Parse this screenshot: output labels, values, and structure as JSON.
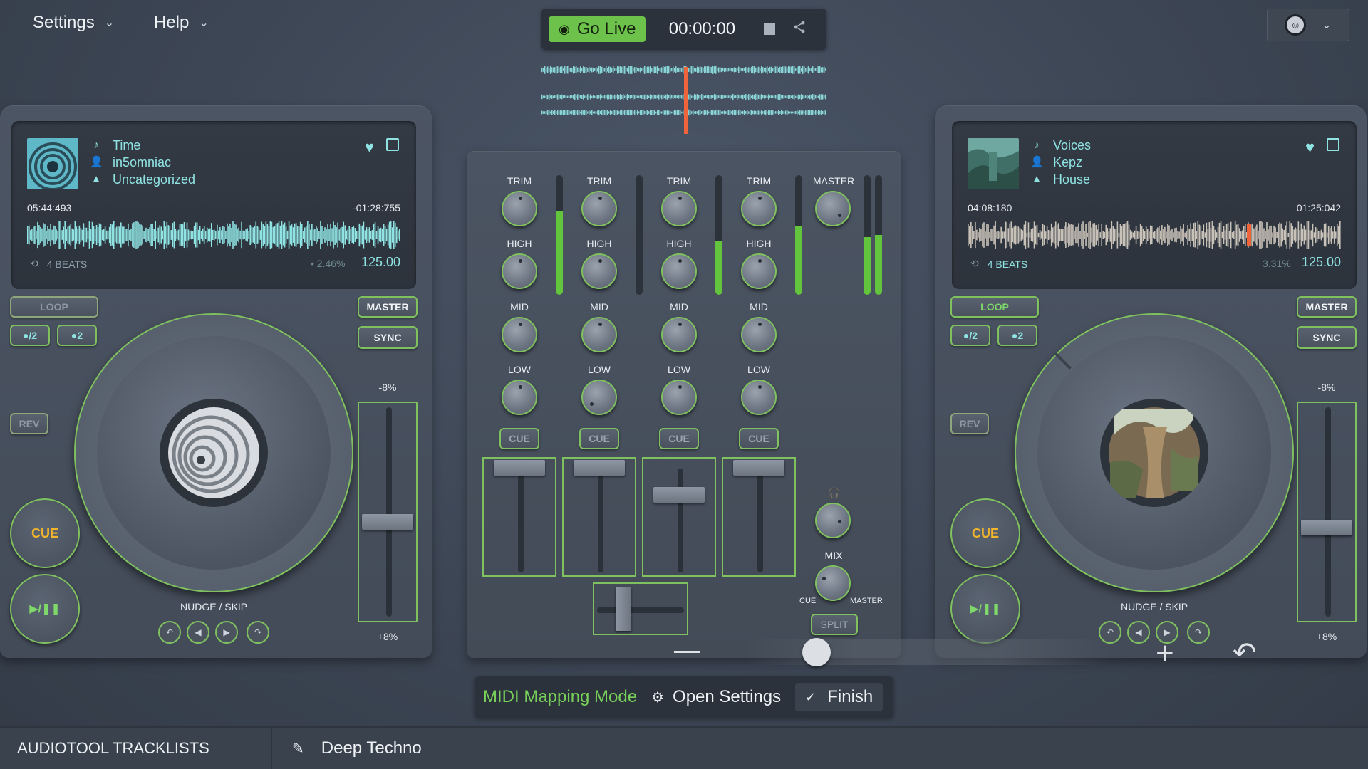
{
  "menu": {
    "settings": "Settings",
    "help": "Help"
  },
  "transport": {
    "go_live": "Go Live",
    "timer": "00:00:00"
  },
  "deck_a": {
    "title": "Time",
    "artist": "in5omniac",
    "genre": "Uncategorized",
    "elapsed": "05:44:493",
    "remaining": "-01:28:755",
    "loop_length": "4 BEATS",
    "pitch_percent": "2.46%",
    "bpm": "125.00",
    "loop": "LOOP",
    "half": "●/2",
    "double": "●2",
    "master": "MASTER",
    "sync": "SYNC",
    "rev": "REV",
    "cue": "CUE",
    "play": "▶/❚❚",
    "nudge": "NUDGE / SKIP",
    "pitch_top": "-8%",
    "pitch_bottom": "+8%",
    "pitch_fader_level": 0.55
  },
  "deck_b": {
    "title": "Voices",
    "artist": "Kepz",
    "genre": "House",
    "elapsed": "04:08:180",
    "remaining": "01:25:042",
    "loop_length": "4 BEATS",
    "pitch_percent": "3.31%",
    "bpm": "125.00",
    "loop": "LOOP",
    "half": "●/2",
    "double": "●2",
    "master": "MASTER",
    "sync": "SYNC",
    "rev": "REV",
    "cue": "CUE",
    "play": "▶/❚❚",
    "nudge": "NUDGE / SKIP",
    "pitch_top": "-8%",
    "pitch_bottom": "+8%",
    "pitch_fader_level": 0.58
  },
  "mixer": {
    "trim": "TRIM",
    "high": "HIGH",
    "mid": "MID",
    "low": "LOW",
    "cue": "CUE",
    "master": "MASTER",
    "mix": "MIX",
    "mix_cue": "CUE",
    "mix_master": "MASTER",
    "split": "SPLIT",
    "headphones_icon": "headphones-icon"
  },
  "midi": {
    "mode": "MIDI Mapping Mode",
    "open_settings": "Open Settings",
    "finish": "Finish"
  },
  "footer": {
    "left": "AUDIOTOOL TRACKLISTS",
    "playlist": "Deep Techno"
  },
  "colors": {
    "accent": "#7fc15e",
    "cyan": "#8fe3e3",
    "cue": "#f3b52b",
    "playhead": "#f0643c"
  }
}
